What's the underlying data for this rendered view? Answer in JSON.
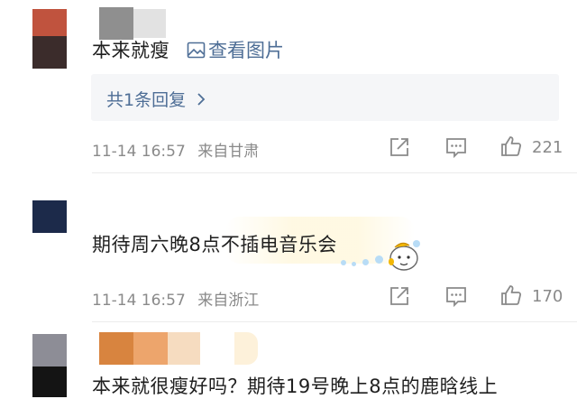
{
  "colors": {
    "link_blue": "#4e6e96",
    "meta_gray": "#8a8a8a",
    "reply_bg": "#f5f6f8"
  },
  "comments": [
    {
      "text": "本来就瘦",
      "view_image_label": "查看图片",
      "view_image_icon": "image-icon",
      "replies_label": "共1条回复",
      "time": "11-14 16:57",
      "location": "来自甘肃",
      "likes": "221"
    },
    {
      "text": "期待周六晚8点不插电音乐会",
      "time": "11-14 16:57",
      "location": "来自浙江",
      "likes": "170"
    },
    {
      "text": "本来就很瘦好吗？期待19号晚上8点的鹿晗线上"
    }
  ],
  "action_icons": [
    "share-icon",
    "comment-icon",
    "like-icon"
  ]
}
